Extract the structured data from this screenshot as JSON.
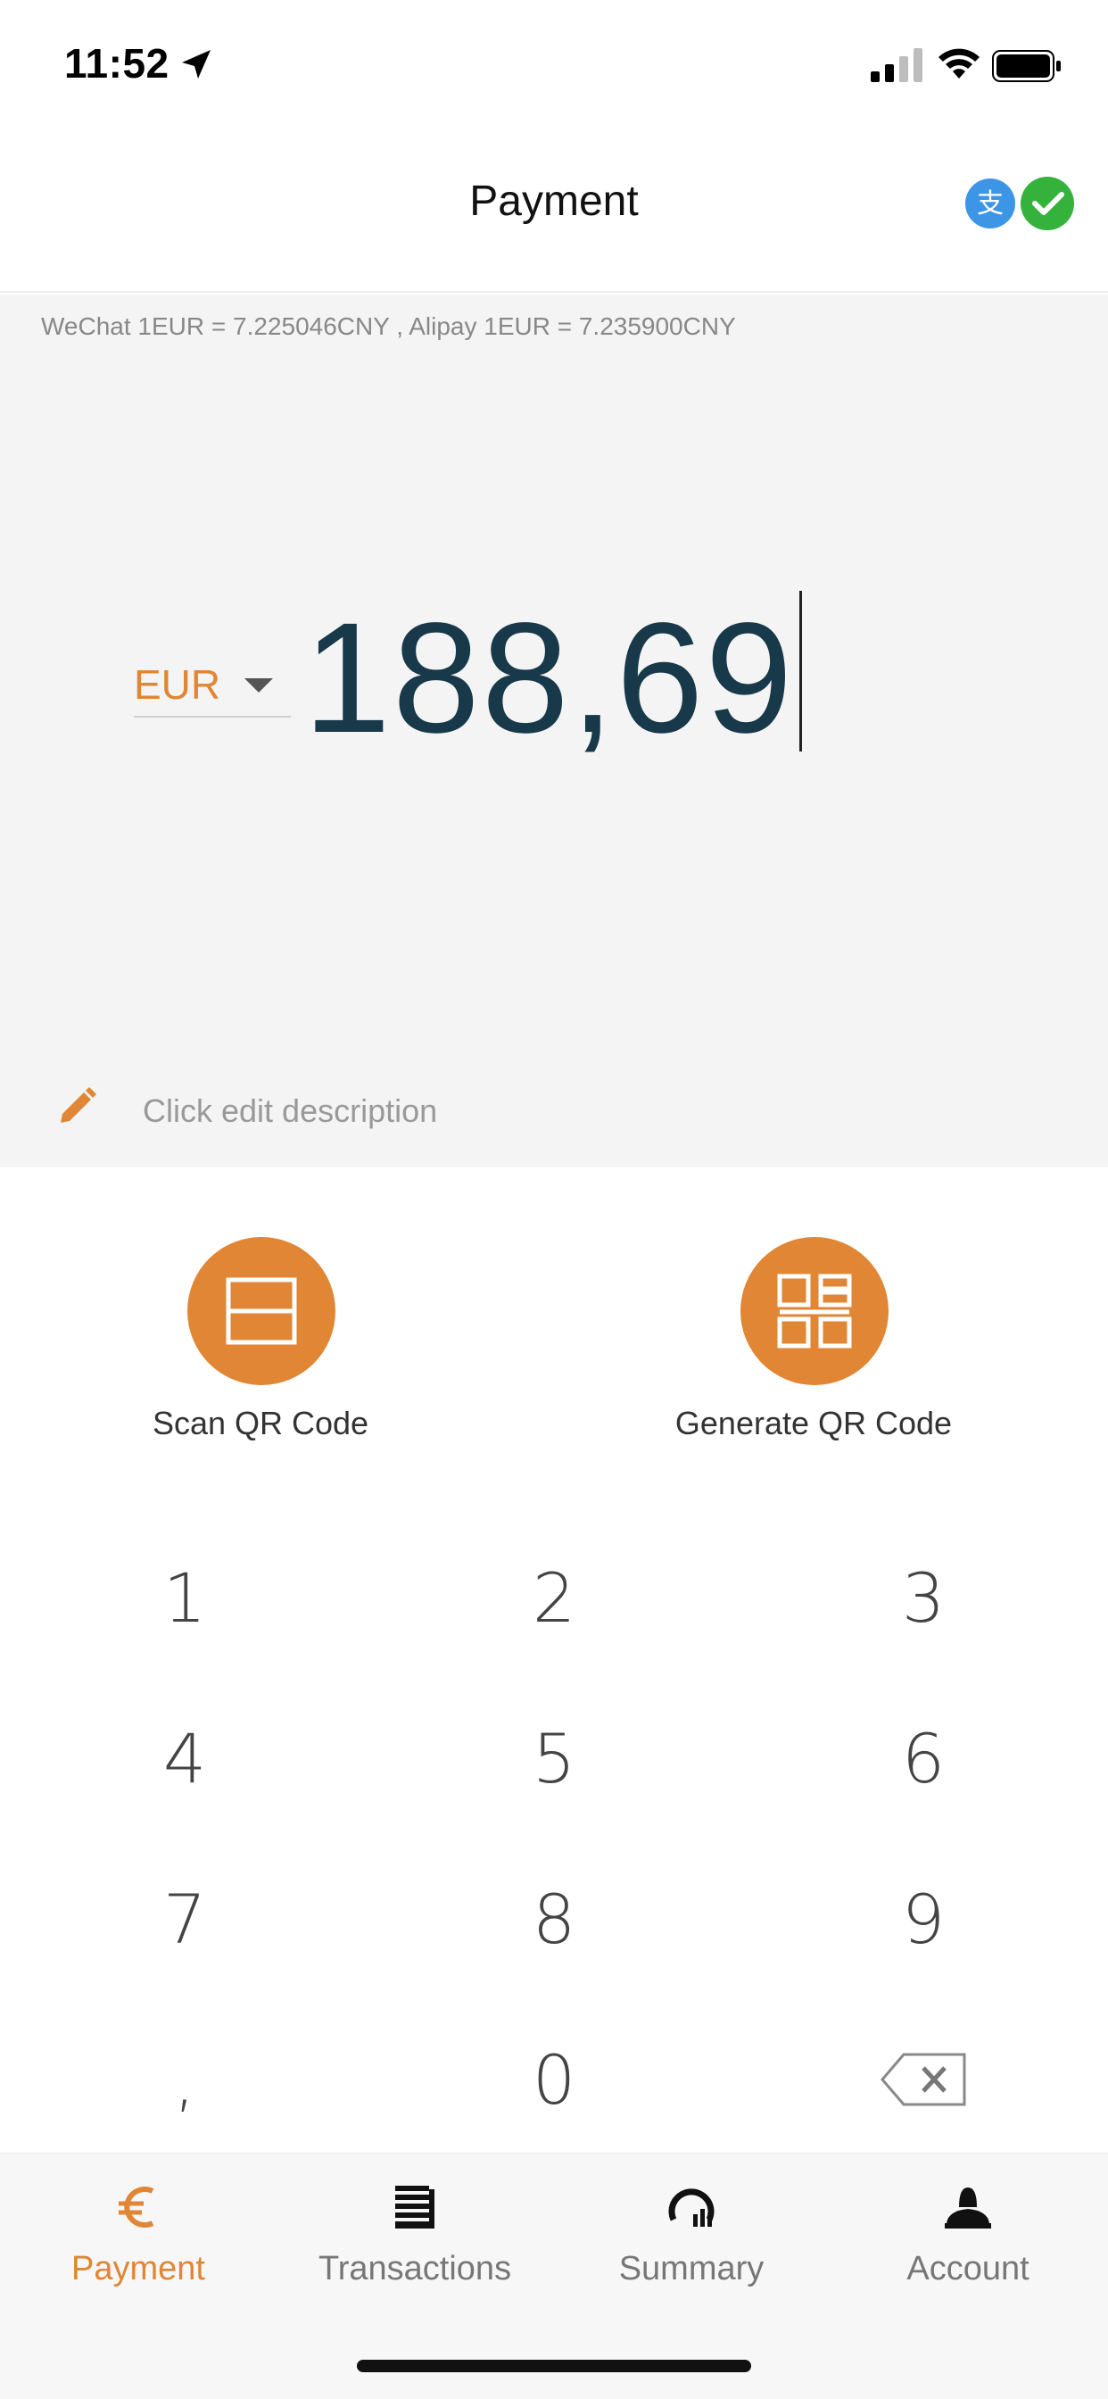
{
  "status_bar": {
    "time": "11:52",
    "icons": [
      "location-arrow-icon",
      "cellular-signal-icon",
      "wifi-icon",
      "battery-icon"
    ]
  },
  "header": {
    "title": "Payment",
    "badges": [
      "alipay-icon",
      "wechat-pay-icon"
    ]
  },
  "rates": {
    "text": "WeChat 1EUR = 7.225046CNY , Alipay 1EUR = 7.235900CNY"
  },
  "amount": {
    "currency": "EUR",
    "value": "188,69"
  },
  "description": {
    "placeholder": "Click edit description"
  },
  "actions": {
    "scan_label": "Scan QR Code",
    "generate_label": "Generate QR Code"
  },
  "keypad": {
    "keys": [
      "1",
      "2",
      "3",
      "4",
      "5",
      "6",
      "7",
      "8",
      "9",
      ",",
      "0",
      "backspace"
    ]
  },
  "tabs": [
    {
      "label": "Payment",
      "icon": "euro-icon",
      "active": true
    },
    {
      "label": "Transactions",
      "icon": "receipt-icon",
      "active": false
    },
    {
      "label": "Summary",
      "icon": "gauge-icon",
      "active": false
    },
    {
      "label": "Account",
      "icon": "user-icon",
      "active": false
    }
  ],
  "colors": {
    "accent": "#e08634",
    "amount_text": "#17394a",
    "alipay": "#3d95e6",
    "wechat": "#35b23c"
  }
}
